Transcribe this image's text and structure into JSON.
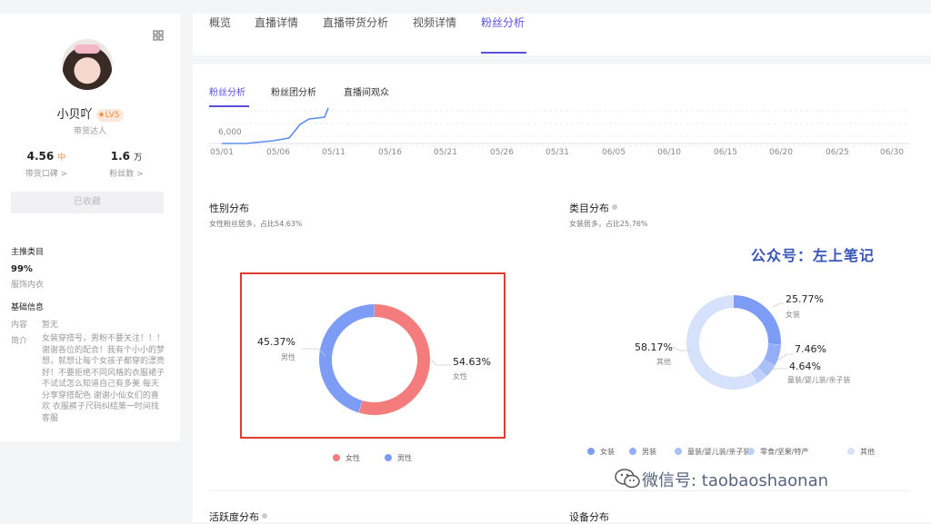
{
  "profile": {
    "name": "小贝吖",
    "level": "LV5",
    "role": "带货达人",
    "stats": [
      {
        "value": "4.56",
        "unit": "中",
        "label": "带货口碑 >"
      },
      {
        "value": "1.6",
        "unit": "万",
        "label": "粉丝数 >"
      }
    ],
    "collected_label": "已收藏",
    "main_category_title": "主推类目",
    "main_category_pct": "99%",
    "main_category_name": "服饰内衣",
    "basic_info_title": "基础信息",
    "content_key": "内容",
    "content_val": "暂无",
    "bio_key": "简介",
    "bio_val": "女装穿搭号，男粉不要关注！！！谢谢各位的配合！我有个小小的梦想，就想让每个女孩子都穿的漂亮好！不要拒绝不同风格的衣服裙子 不试试怎么知道自己有多美 每天分享穿搭配色 谢谢小仙女们的喜欢 衣服裤子尺码纠结第一时间找客服"
  },
  "tabs": [
    "概览",
    "直播详情",
    "直播带货分析",
    "视频详情",
    "粉丝分析"
  ],
  "active_tab": "粉丝分析",
  "subtabs": [
    "粉丝分析",
    "粉丝团分析",
    "直播间观众"
  ],
  "trend": {
    "y_label": "6,000",
    "x_ticks": [
      "05/01",
      "05/06",
      "05/11",
      "05/16",
      "05/21",
      "05/26",
      "05/31",
      "06/05",
      "06/10",
      "06/15",
      "06/20",
      "06/25",
      "06/30"
    ]
  },
  "gender": {
    "title": "性别分布",
    "subtitle": "女性粉丝居多，占比54.63%",
    "female_pct": "54.63%",
    "female_label": "女性",
    "male_pct": "45.37%",
    "male_label": "男性",
    "female_value": 54.63,
    "male_value": 45.37,
    "female_color": "#f47c7c",
    "male_color": "#7d9cf5",
    "legend": [
      {
        "label": "女性",
        "color": "#f47c7c"
      },
      {
        "label": "男性",
        "color": "#7d9cf5"
      }
    ]
  },
  "category": {
    "title": "类目分布",
    "subtitle": "女装居多，占比25.76%",
    "slices": [
      {
        "label": "女装",
        "pct": "25.77%",
        "value": 25.77,
        "color": "#7d9cf5"
      },
      {
        "label": "男装",
        "pct": "7.46%",
        "value": 7.46,
        "color": "#93aef7"
      },
      {
        "label": "童装/婴儿装/亲子装",
        "pct": "4.64%",
        "value": 4.64,
        "color": "#a9bff8"
      },
      {
        "label": "零食/坚果/特产",
        "pct": "3.96%",
        "value": 3.96,
        "color": "#bfd0fa"
      },
      {
        "label": "其他",
        "pct": "58.17%",
        "value": 58.17,
        "color": "#d6e1fc"
      }
    ]
  },
  "bottom": {
    "activity_title": "活跃度分布",
    "device_title": "设备分布"
  },
  "watermarks": {
    "official": "公众号：左上笔记",
    "wechat": "微信号: taobaoshaonan"
  }
}
